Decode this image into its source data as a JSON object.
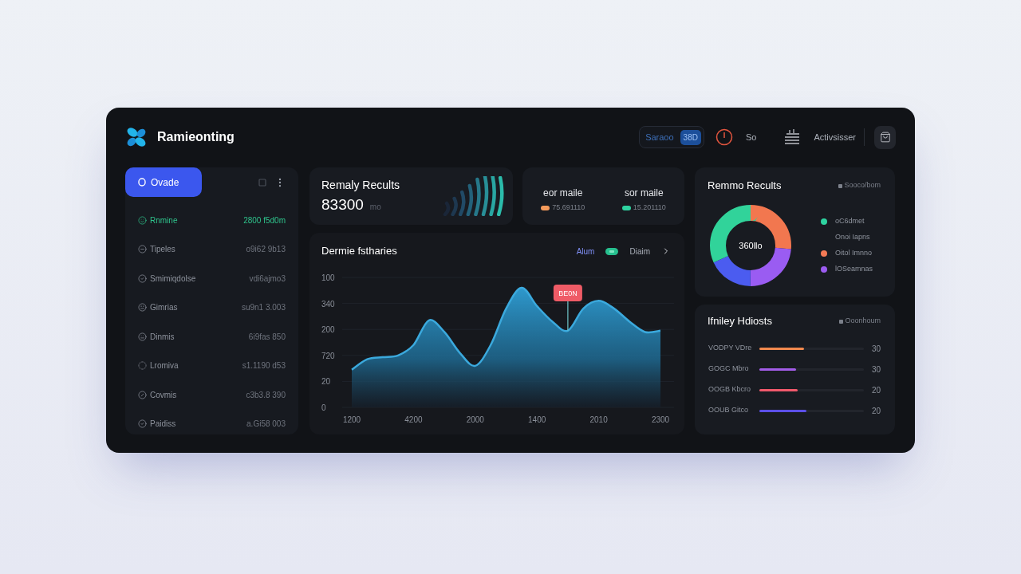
{
  "header": {
    "brand": "Ramieonting",
    "search_pill": {
      "label": "Saraoo",
      "badge": "38D"
    },
    "status_label": "So",
    "user_name": "Activsisser"
  },
  "sidebar": {
    "button": "Ovade",
    "items": [
      {
        "label": "Rnmine",
        "value": "2800 f5d0m",
        "selected": true
      },
      {
        "label": "Tipeles",
        "value": "o9i62 9b13",
        "selected": false
      },
      {
        "label": "Smimiqdolse",
        "value": "vdi6ajmo3",
        "selected": false
      },
      {
        "label": "Gimrias",
        "value": "su9n1 3.003",
        "selected": false
      },
      {
        "label": "Dinmis",
        "value": "6i9fas 850",
        "selected": false
      },
      {
        "label": "Lromiva",
        "value": "s1.1190 d53",
        "selected": false
      },
      {
        "label": "Covmis",
        "value": "c3b3.8 390",
        "selected": false
      },
      {
        "label": "Paidiss",
        "value": "a.Gi58 003",
        "selected": false
      }
    ]
  },
  "summary_card": {
    "title": "Remaly Recults",
    "value": "83300",
    "unit": "mo"
  },
  "stats_card": {
    "items": [
      {
        "label": "eor maile",
        "color": "#f59a5b",
        "value": "75.691110"
      },
      {
        "label": "sor maile",
        "color": "#2ed3a0",
        "value": "15.201110"
      }
    ]
  },
  "trend_card": {
    "title": "Dermie fstharies",
    "tabs": [
      {
        "label": "Alum",
        "selected": true
      },
      {
        "label": "Diaim",
        "selected": false
      }
    ],
    "tooltip": "BE0N",
    "y_axis_labels": [
      "100",
      "340",
      "200",
      "720",
      "20",
      "0"
    ],
    "x_axis_labels": [
      "1200",
      "4200",
      "2000",
      "1400",
      "2010",
      "2300"
    ]
  },
  "donut_card": {
    "title": "Remmo Recults",
    "action": "Sooco/bom",
    "center_label": "360llo",
    "legend": [
      {
        "label": "oC6dmet",
        "color": "#2ed3a0"
      },
      {
        "label": "Onoi Iapns"
      },
      {
        "label": "Oitol Imnno",
        "color": "#f47a55"
      },
      {
        "label": "lOSeamnas",
        "color": "#9b5cf0"
      }
    ]
  },
  "bars_card": {
    "title": "Ifniley Hdiosts",
    "action": "Ooonhoum",
    "rows": [
      {
        "label": "VODPY VDre",
        "level": 0.43,
        "value": "30",
        "color": "#f2894e"
      },
      {
        "label": "GOGC Mbro",
        "level": 0.35,
        "value": "30",
        "color": "#a25ce8"
      },
      {
        "label": "OOGB Kbcro",
        "level": 0.37,
        "value": "20",
        "color": "#f0596b"
      },
      {
        "label": "OOUB Gitco",
        "level": 0.45,
        "value": "20",
        "color": "#5b4fe8"
      }
    ]
  }
}
